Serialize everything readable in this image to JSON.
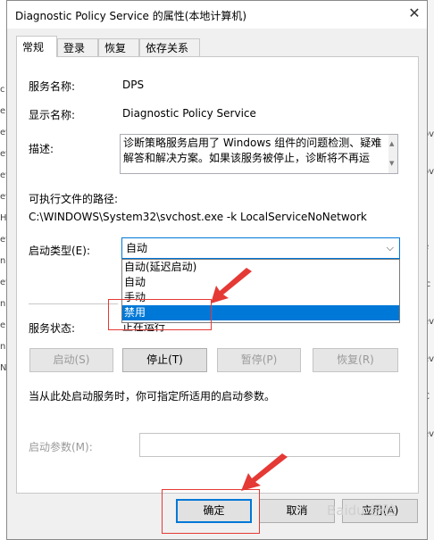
{
  "window": {
    "title": "Diagnostic Policy Service 的属性(本地计算机)"
  },
  "tabs": [
    {
      "label": "常规"
    },
    {
      "label": "登录"
    },
    {
      "label": "恢复"
    },
    {
      "label": "依存关系"
    }
  ],
  "general": {
    "service_name_label": "服务名称:",
    "service_name_value": "DPS",
    "display_name_label": "显示名称:",
    "display_name_value": "Diagnostic Policy Service",
    "description_label": "描述:",
    "description_value": "诊断策略服务启用了 Windows 组件的问题检测、疑难解答和解决方案。如果该服务被停止，诊断将不再运",
    "exe_path_label": "可执行文件的路径:",
    "exe_path_value": "C:\\WINDOWS\\System32\\svchost.exe -k LocalServiceNoNetwork",
    "startup_type_label": "启动类型(E):",
    "startup_type_value": "自动",
    "startup_options": [
      "自动(延迟启动)",
      "自动",
      "手动",
      "禁用"
    ],
    "highlighted_option": "禁用",
    "service_status_label": "服务状态:",
    "service_status_value": "正在运行",
    "start_button": "启动(S)",
    "stop_button": "停止(T)",
    "pause_button": "暂停(P)",
    "resume_button": "恢复(R)",
    "hint_text": "当从此处启动服务时，你可指定所适用的启动参数。",
    "start_params_label": "启动参数(M):"
  },
  "footer": {
    "ok_button": "确定",
    "cancel_button": "取消",
    "apply_button": "应用(A)"
  },
  "watermark_text": "Baidu 经验",
  "background_chars": [
    "c",
    "e",
    "ev",
    "ev",
    "ev",
    "ev",
    "H",
    "ev",
    "n",
    "ev",
    "n",
    "e",
    "n",
    "N",
    "ov",
    "ov",
    "c",
    "e",
    "ic",
    "ev",
    "ev",
    "C",
    "ev",
    "c"
  ],
  "colors": {
    "accent": "#0078d7",
    "annotation_red": "#e53935"
  }
}
